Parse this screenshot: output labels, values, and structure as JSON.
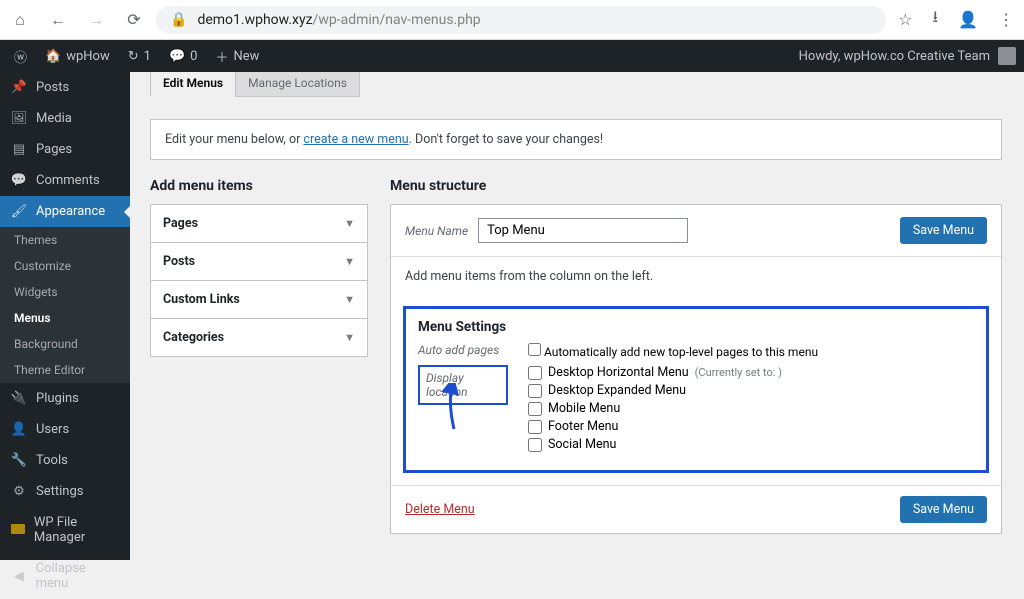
{
  "browser": {
    "url_host": "demo1.wphow.xyz",
    "url_path": "/wp-admin/nav-menus.php"
  },
  "adminbar": {
    "site_name": "wpHow",
    "updates": "1",
    "comments": "0",
    "new_label": "New",
    "howdy": "Howdy, wpHow.co Creative Team"
  },
  "sidebar": {
    "posts": "Posts",
    "media": "Media",
    "pages": "Pages",
    "comments": "Comments",
    "appearance": "Appearance",
    "plugins": "Plugins",
    "users": "Users",
    "tools": "Tools",
    "settings": "Settings",
    "wpfile": "WP File Manager",
    "collapse": "Collapse menu",
    "sub": {
      "themes": "Themes",
      "customize": "Customize",
      "widgets": "Widgets",
      "menus": "Menus",
      "background": "Background",
      "themeeditor": "Theme Editor"
    }
  },
  "tabs": {
    "edit": "Edit Menus",
    "manage": "Manage Locations"
  },
  "notice": {
    "prefix": "Edit your menu below, or ",
    "link": "create a new menu",
    "suffix": ". Don't forget to save your changes!"
  },
  "add_items": {
    "heading": "Add menu items",
    "pages": "Pages",
    "posts": "Posts",
    "custom": "Custom Links",
    "categories": "Categories"
  },
  "structure": {
    "heading": "Menu structure",
    "name_label": "Menu Name",
    "name_value": "Top Menu",
    "save": "Save Menu",
    "body_hint": "Add menu items from the column on the left."
  },
  "settings": {
    "heading": "Menu Settings",
    "auto_label": "Auto add pages",
    "auto_check": "Automatically add new top-level pages to this menu",
    "display_label": "Display location",
    "loc1": "Desktop Horizontal Menu",
    "loc1_note": "(Currently set to: )",
    "loc2": "Desktop Expanded Menu",
    "loc3": "Mobile Menu",
    "loc4": "Footer Menu",
    "loc5": "Social Menu"
  },
  "footer": {
    "delete": "Delete Menu",
    "save": "Save Menu"
  }
}
